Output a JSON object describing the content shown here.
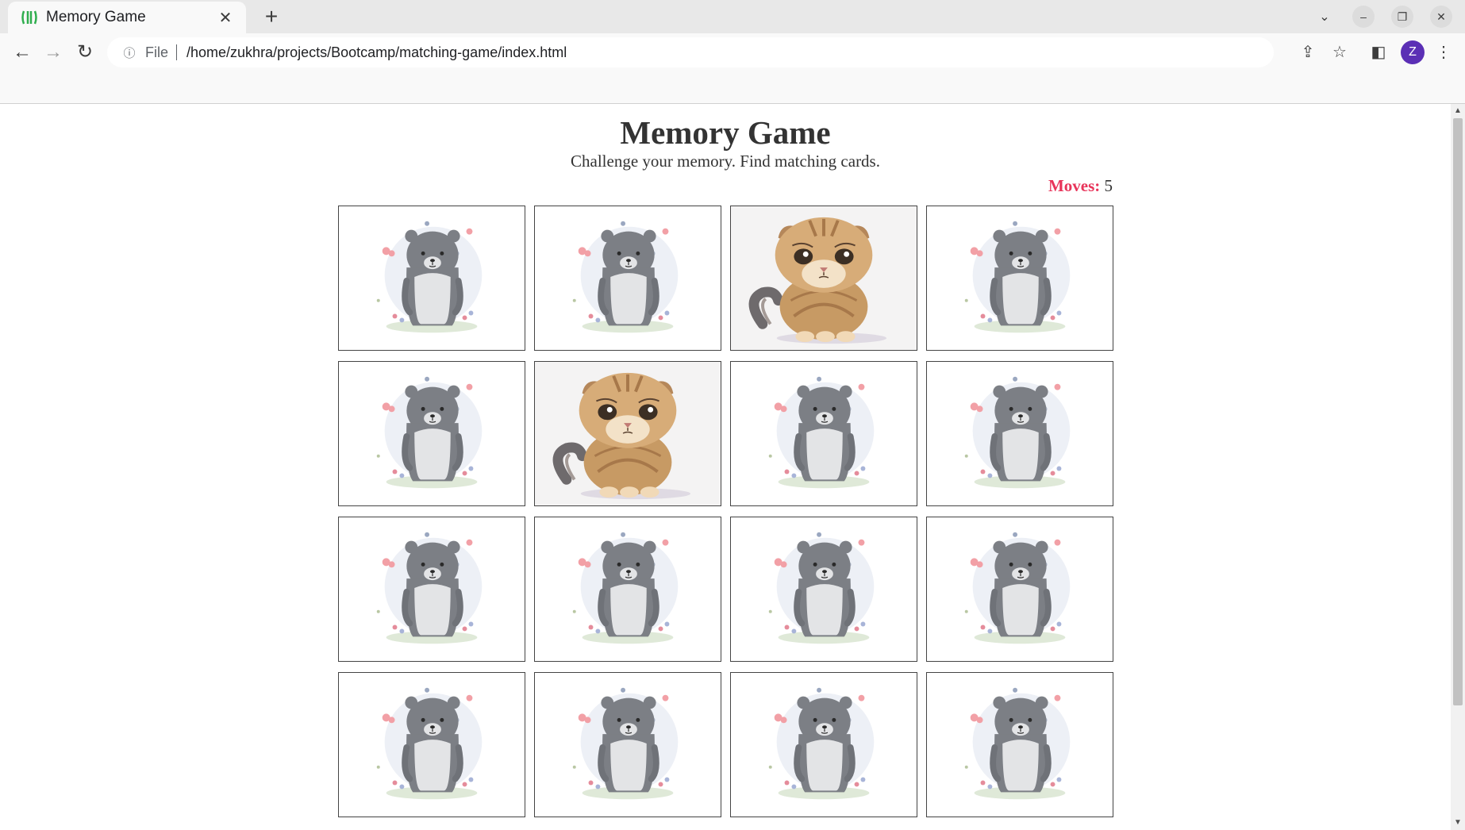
{
  "browser": {
    "tab_title": "Memory Game",
    "omnibox_file_label": "File",
    "url": "/home/zukhra/projects/Bootcamp/matching-game/index.html",
    "avatar_letter": "Z"
  },
  "page": {
    "title": "Memory Game",
    "subtitle": "Challenge your memory. Find matching cards.",
    "moves_label": "Moves:",
    "moves_value": "5"
  },
  "cards": [
    {
      "face": "bear",
      "flipped": false
    },
    {
      "face": "bear",
      "flipped": false
    },
    {
      "face": "cat",
      "flipped": true
    },
    {
      "face": "bear",
      "flipped": false
    },
    {
      "face": "bear",
      "flipped": false
    },
    {
      "face": "cat",
      "flipped": true
    },
    {
      "face": "bear",
      "flipped": false
    },
    {
      "face": "bear",
      "flipped": false
    },
    {
      "face": "bear",
      "flipped": false
    },
    {
      "face": "bear",
      "flipped": false
    },
    {
      "face": "bear",
      "flipped": false
    },
    {
      "face": "bear",
      "flipped": false
    },
    {
      "face": "bear",
      "flipped": false
    },
    {
      "face": "bear",
      "flipped": false
    },
    {
      "face": "bear",
      "flipped": false
    },
    {
      "face": "bear",
      "flipped": false
    }
  ],
  "colors": {
    "moves_label": "#e8345a",
    "avatar": "#5b2fb5",
    "favicon": "#2fae4e"
  },
  "icons": [
    "favicon-icon",
    "close-icon",
    "plus-icon",
    "chevron-down-icon",
    "minimize-icon",
    "restore-icon",
    "window-close-icon",
    "back-icon",
    "forward-icon",
    "reload-icon",
    "info-icon",
    "share-icon",
    "star-icon",
    "side-panel-icon",
    "menu-icon"
  ]
}
